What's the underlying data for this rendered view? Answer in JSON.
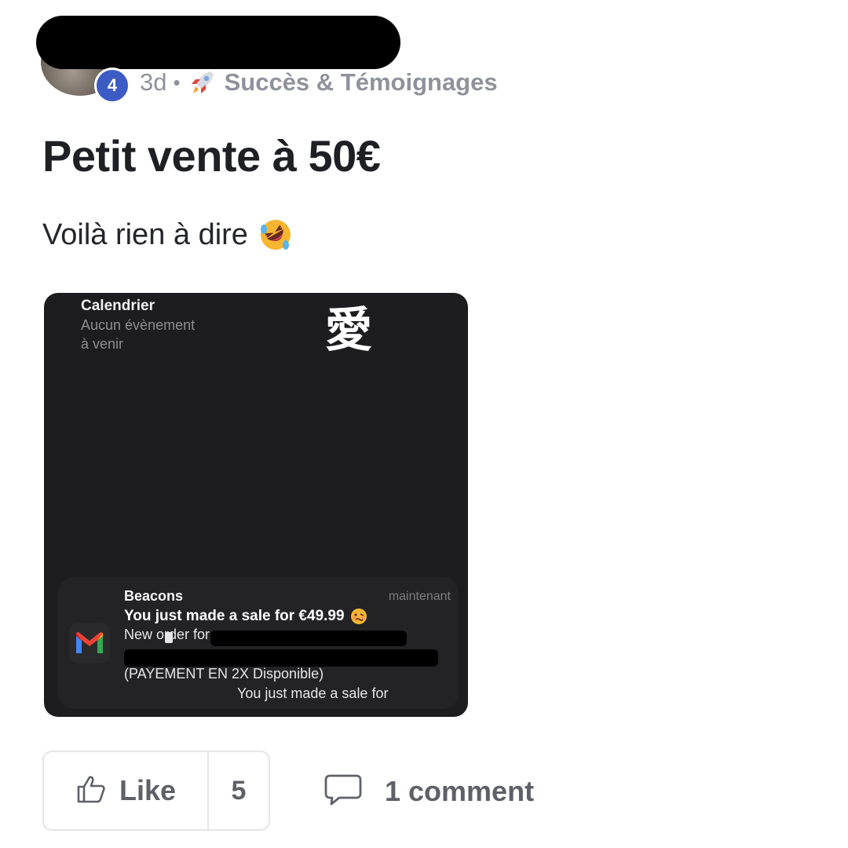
{
  "post": {
    "author": {
      "level": "4"
    },
    "meta": {
      "time": "3d",
      "separator": "•",
      "category_icon": "rocket-icon",
      "category": "Succès & Témoignages"
    },
    "title": "Petit vente à 50€",
    "body": "Voilà rien à dire",
    "body_emoji": "rolling-on-floor-laughing-icon"
  },
  "attachment": {
    "calendar_widget": {
      "title": "Calendrier",
      "line1": "Aucun évènement",
      "line2": "à venir"
    },
    "wallpaper_glyph": "愛",
    "notification": {
      "app_icon": "gmail-icon",
      "app": "Beacons",
      "time": "maintenant",
      "headline": "You just made a sale for €49.99",
      "headline_emoji": "woozy-face-icon",
      "line1": "New order for",
      "line3": "(PAYEMENT EN 2X Disponible)",
      "line4": "You just made a sale for"
    }
  },
  "actions": {
    "like_label": "Like",
    "like_count": "5",
    "comment_label": "1 comment"
  },
  "colors": {
    "level_badge": "#3d5bc4",
    "meta_text": "#8f929a",
    "title_text": "#1e2024",
    "image_background": "#1d1d1f"
  }
}
